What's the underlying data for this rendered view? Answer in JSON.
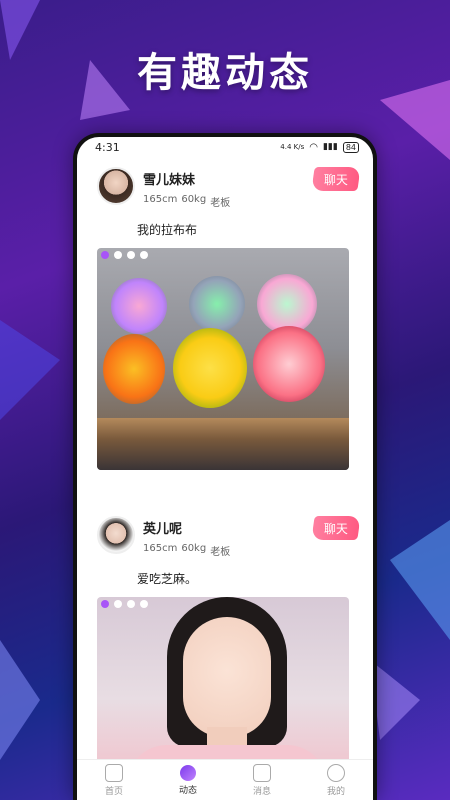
{
  "promo": {
    "title": "有趣动态"
  },
  "status_bar": {
    "time": "4:31",
    "network": "4.4 K/s",
    "battery": "84"
  },
  "posts": [
    {
      "nickname": "雪儿妹妹",
      "height": "165cm",
      "weight": "60kg",
      "occupation": "老板",
      "chat_label": "聊天",
      "text": "我的拉布布",
      "photo_dots": 4,
      "active_dot": 0
    },
    {
      "nickname": "英儿呢",
      "height": "165cm",
      "weight": "60kg",
      "occupation": "老板",
      "chat_label": "聊天",
      "text": "爱吃芝麻。",
      "photo_dots": 4,
      "active_dot": 0
    }
  ],
  "tab_bar": [
    {
      "label": "首页",
      "icon": "home-icon",
      "active": false
    },
    {
      "label": "动态",
      "icon": "moments-icon",
      "active": true
    },
    {
      "label": "消息",
      "icon": "message-icon",
      "active": false
    },
    {
      "label": "我的",
      "icon": "profile-icon",
      "active": false
    }
  ],
  "colors": {
    "accent": "#a855f7",
    "chat_button": "#ff5a82"
  }
}
